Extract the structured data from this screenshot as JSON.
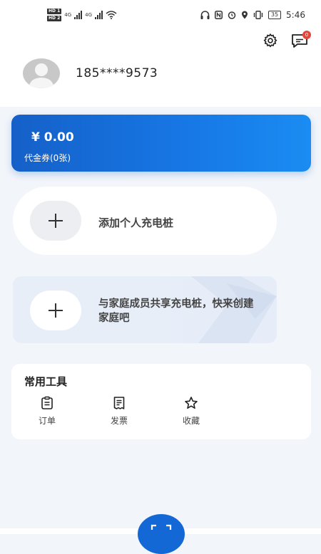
{
  "status_bar": {
    "hd_top": "HD 1",
    "hd_bottom": "HD 2",
    "net1": "4G",
    "net2": "4G",
    "battery": "35",
    "time": "5:46"
  },
  "header": {
    "phone": "185****9573",
    "message_badge": "0",
    "icons": [
      "gear-icon",
      "message-icon"
    ]
  },
  "wallet": {
    "balance": "¥ 0.00",
    "voucher": "代金券(0张)",
    "accent": "#1778e6"
  },
  "personal_pile": {
    "label": "添加个人充电桩"
  },
  "family": {
    "label": "与家庭成员共享充电桩，快来创建家庭吧"
  },
  "tools": {
    "title": "常用工具",
    "items": [
      {
        "label": "订单",
        "icon": "order-icon"
      },
      {
        "label": "发票",
        "icon": "invoice-icon"
      },
      {
        "label": "收藏",
        "icon": "star-icon"
      }
    ]
  },
  "bottom": {
    "scan_icon": "scan-icon"
  }
}
